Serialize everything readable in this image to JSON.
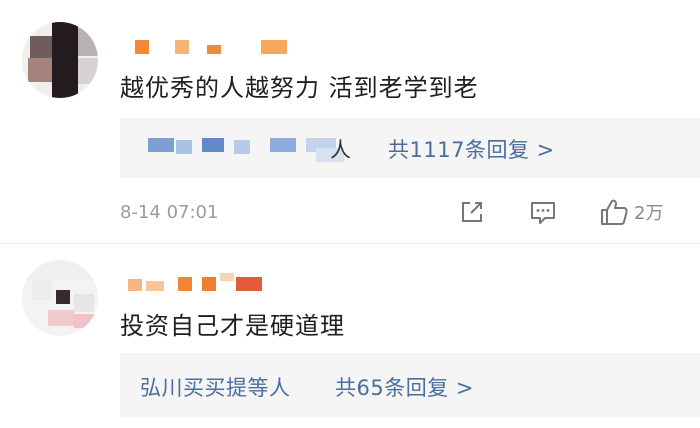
{
  "comments": [
    {
      "text": "越优秀的人越努力  活到老学到老",
      "replies_suffix": "人",
      "replies_count_label": "共1117条回复 >",
      "timestamp": "8-14 07:01",
      "likes": "2万"
    },
    {
      "text": "投资自己才是硬道理",
      "replies_names": "弘川买买提等人",
      "replies_count_label": "共65条回复 >"
    }
  ],
  "icons": [
    "share-icon",
    "comment-icon",
    "like-icon"
  ],
  "colors": {
    "link": "#4a6e9f",
    "muted": "#9b9b9b",
    "reply_bg": "#f5f5f5"
  }
}
